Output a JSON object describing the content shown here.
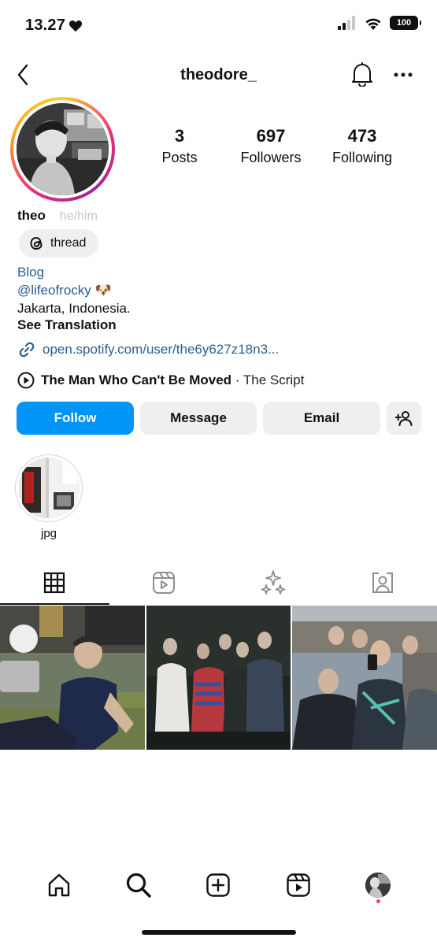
{
  "status_bar": {
    "time": "13.27",
    "battery": "100",
    "icons": [
      "heart-icon",
      "signal-icon",
      "wifi-icon",
      "battery-icon"
    ]
  },
  "header": {
    "username": "theodore_",
    "icons": [
      "back-chevron-icon",
      "bell-icon",
      "more-icon"
    ]
  },
  "profile": {
    "stats": [
      {
        "value": "3",
        "label": "Posts"
      },
      {
        "value": "697",
        "label": "Followers"
      },
      {
        "value": "473",
        "label": "Following"
      }
    ],
    "name": "theo",
    "pronouns": "he/him",
    "threads_badge": "thread",
    "bio": {
      "category": "Blog",
      "mention": "@lifeofrocky",
      "emoji": "🐶",
      "location": "Jakarta, Indonesia.",
      "see_translation": "See Translation"
    },
    "link": "open.spotify.com/user/the6y627z18n3...",
    "music": {
      "title": "The Man Who Can't Be Moved",
      "separator": " · ",
      "artist": "The Script"
    }
  },
  "actions": {
    "follow": "Follow",
    "message": "Message",
    "email": "Email"
  },
  "highlights": [
    {
      "label": "jpg"
    }
  ],
  "tabs": [
    {
      "name": "posts-grid",
      "icon": "grid-icon",
      "active": true
    },
    {
      "name": "reels",
      "icon": "reels-icon",
      "active": false
    },
    {
      "name": "ai-sparkle",
      "icon": "sparkle-icon",
      "active": false
    },
    {
      "name": "tagged",
      "icon": "tagged-person-icon",
      "active": false
    }
  ],
  "bottom_nav": [
    "home-icon",
    "search-icon",
    "create-icon",
    "reels-icon",
    "profile-avatar"
  ],
  "colors": {
    "accent": "#0095f6",
    "link": "#2b5f8f",
    "button_bg": "#efefef",
    "notification_dot": "#ed4956"
  }
}
